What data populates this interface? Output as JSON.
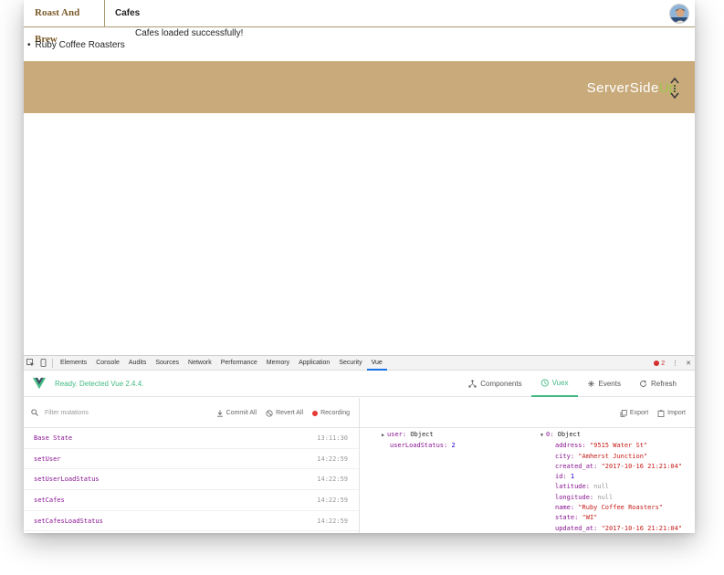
{
  "app": {
    "brand": "Roast And Brew",
    "nav": {
      "cafes": "Cafes"
    },
    "notification": "Cafes loaded successfully!",
    "cafes": [
      "Ruby Coffee Roasters"
    ],
    "banner": {
      "logo_main": "ServerSide",
      "logo_accent": "Up"
    }
  },
  "devtools": {
    "tabs": [
      "Elements",
      "Console",
      "Audits",
      "Sources",
      "Network",
      "Performance",
      "Memory",
      "Application",
      "Security",
      "Vue"
    ],
    "active_tab": "Vue",
    "error_count": "2",
    "vue": {
      "ready_text": "Ready. Detected Vue 2.4.4.",
      "nav": [
        {
          "label": "Components",
          "icon": "components-icon"
        },
        {
          "label": "Vuex",
          "icon": "history-icon",
          "active": true
        },
        {
          "label": "Events",
          "icon": "events-icon"
        },
        {
          "label": "Refresh",
          "icon": "refresh-icon"
        }
      ]
    },
    "mutations_toolbar": {
      "filter_placeholder": "Filter mutations",
      "commit_all": "Commit All",
      "revert_all": "Revert All",
      "recording": "Recording"
    },
    "mutations": [
      {
        "name": "Base State",
        "time": "13:11:30"
      },
      {
        "name": "setUser",
        "time": "14:22:59"
      },
      {
        "name": "setUserLoadStatus",
        "time": "14:22:59"
      },
      {
        "name": "setCafes",
        "time": "14:22:59"
      },
      {
        "name": "setCafesLoadStatus",
        "time": "14:22:59"
      }
    ],
    "state_toolbar": {
      "export": "Export",
      "import": "Import"
    },
    "state": {
      "user_key": "user:",
      "user_val": "Object",
      "userLoadStatus_key": "userLoadStatus:",
      "userLoadStatus_val": "2",
      "item_key": "0:",
      "item_val": "Object",
      "fields": [
        {
          "key": "address:",
          "value": "\"9515 Water St\"",
          "kind": "str"
        },
        {
          "key": "city:",
          "value": "\"Amherst Junction\"",
          "kind": "str"
        },
        {
          "key": "created_at:",
          "value": "\"2017-10-16 21:21:04\"",
          "kind": "str"
        },
        {
          "key": "id:",
          "value": "1",
          "kind": "num"
        },
        {
          "key": "latitude:",
          "value": "null",
          "kind": "nul"
        },
        {
          "key": "longitude:",
          "value": "null",
          "kind": "nul"
        },
        {
          "key": "name:",
          "value": "\"Ruby Coffee Roasters\"",
          "kind": "str"
        },
        {
          "key": "state:",
          "value": "\"WI\"",
          "kind": "str"
        },
        {
          "key": "updated_at:",
          "value": "\"2017-10-16 21:21:04\"",
          "kind": "str"
        }
      ]
    }
  },
  "colors": {
    "banner": "#c9ab7b",
    "brand_text": "#7b5a2a",
    "vue_green": "#42b983",
    "mutation_name": "#881391",
    "string_value": "#c41a16"
  }
}
